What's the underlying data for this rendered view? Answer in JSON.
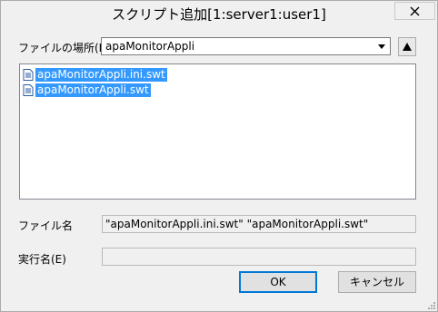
{
  "window": {
    "title": "スクリプト追加[1:server1:user1]",
    "close_icon": "close-icon"
  },
  "location": {
    "label": "ファイルの場所(I)",
    "value": "apaMonitorAppli",
    "dropdown_icon": "chevron-down-icon",
    "up_icon": "up-folder-icon"
  },
  "files": [
    {
      "name": "apaMonitorAppli.ini.swt",
      "icon": "file-icon",
      "selected": true
    },
    {
      "name": "apaMonitorAppli.swt",
      "icon": "file-icon",
      "selected": true
    }
  ],
  "filename": {
    "label": "ファイル名",
    "value": "\"apaMonitorAppli.ini.swt\" \"apaMonitorAppli.swt\""
  },
  "exec_name": {
    "label": "実行名(E)",
    "value": ""
  },
  "buttons": {
    "ok": "OK",
    "cancel": "キャンセル"
  },
  "colors": {
    "selection": "#3399ff",
    "focus_border": "#0078d7",
    "window_bg": "#f0f0f0"
  }
}
